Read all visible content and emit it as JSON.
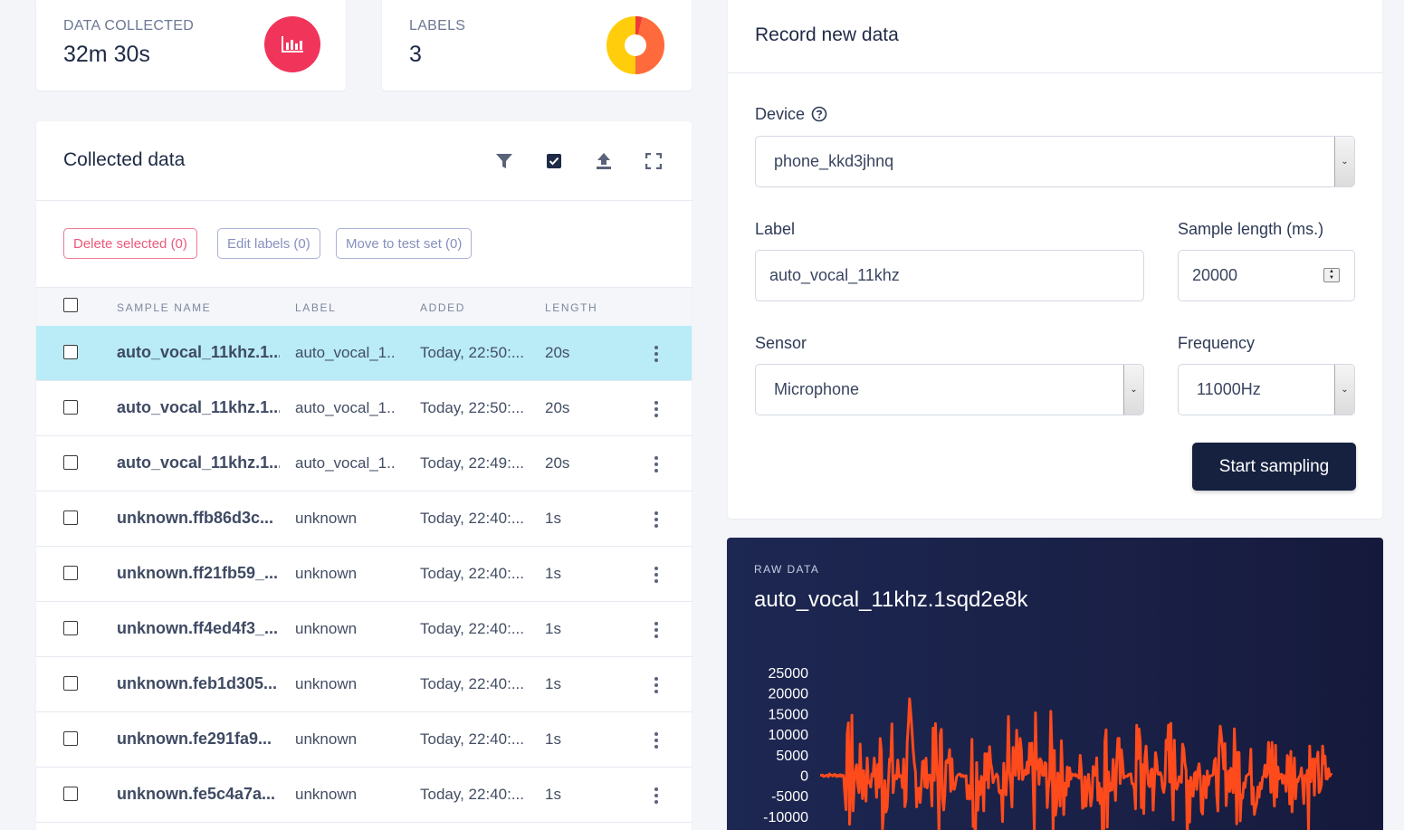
{
  "stats": {
    "data_collected": {
      "label": "DATA COLLECTED",
      "value": "32m 30s",
      "icon": "bar-chart-icon",
      "color": "#f0345a"
    },
    "labels": {
      "label": "LABELS",
      "value": "3",
      "icon": "donut-chart-icon"
    }
  },
  "collected": {
    "title": "Collected data",
    "tools": [
      "filter-icon",
      "select-checkbox-icon",
      "upload-icon",
      "fullscreen-icon"
    ],
    "actions": {
      "delete": "Delete selected (0)",
      "edit": "Edit labels (0)",
      "move": "Move to test set (0)"
    },
    "columns": {
      "name": "SAMPLE NAME",
      "label": "LABEL",
      "added": "ADDED",
      "length": "LENGTH"
    },
    "rows": [
      {
        "name": "auto_vocal_11khz.1...",
        "label": "auto_vocal_1...",
        "added": "Today, 22:50:...",
        "length": "20s"
      },
      {
        "name": "auto_vocal_11khz.1...",
        "label": "auto_vocal_1...",
        "added": "Today, 22:50:...",
        "length": "20s"
      },
      {
        "name": "auto_vocal_11khz.1...",
        "label": "auto_vocal_1...",
        "added": "Today, 22:49:...",
        "length": "20s"
      },
      {
        "name": "unknown.ffb86d3c...",
        "label": "unknown",
        "added": "Today, 22:40:...",
        "length": "1s"
      },
      {
        "name": "unknown.ff21fb59_...",
        "label": "unknown",
        "added": "Today, 22:40:...",
        "length": "1s"
      },
      {
        "name": "unknown.ff4ed4f3_...",
        "label": "unknown",
        "added": "Today, 22:40:...",
        "length": "1s"
      },
      {
        "name": "unknown.feb1d305...",
        "label": "unknown",
        "added": "Today, 22:40:...",
        "length": "1s"
      },
      {
        "name": "unknown.fe291fa9...",
        "label": "unknown",
        "added": "Today, 22:40:...",
        "length": "1s"
      },
      {
        "name": "unknown.fe5c4a7a...",
        "label": "unknown",
        "added": "Today, 22:40:...",
        "length": "1s"
      }
    ]
  },
  "record": {
    "title": "Record new data",
    "device_label": "Device",
    "device_value": "phone_kkd3jhnq",
    "label_label": "Label",
    "label_value": "auto_vocal_11khz",
    "length_label": "Sample length (ms.)",
    "length_value": "20000",
    "sensor_label": "Sensor",
    "sensor_value": "Microphone",
    "freq_label": "Frequency",
    "freq_value": "11000Hz",
    "start_button": "Start sampling"
  },
  "raw": {
    "kicker": "RAW DATA",
    "title": "auto_vocal_11khz.1sqd2e8k"
  },
  "chart_data": {
    "type": "line",
    "series_color": "#ff4a1c",
    "ylim": [
      -10000,
      25000
    ],
    "y_ticks": [
      "25000",
      "20000",
      "15000",
      "10000",
      "5000",
      "0",
      "-5000",
      "-10000"
    ],
    "y_tick_values": [
      25000,
      20000,
      15000,
      10000,
      5000,
      0,
      -5000,
      -10000
    ],
    "x_range": [
      0,
      20000
    ],
    "bursts": [
      {
        "x": 1200,
        "amp": 18000
      },
      {
        "x": 1700,
        "amp": 12000
      },
      {
        "x": 2400,
        "amp": 20000
      },
      {
        "x": 2800,
        "amp": 14000
      },
      {
        "x": 3500,
        "amp": 20000
      },
      {
        "x": 3900,
        "amp": 12000
      },
      {
        "x": 4600,
        "amp": 22000
      },
      {
        "x": 5000,
        "amp": 10000
      },
      {
        "x": 6000,
        "amp": 18000
      },
      {
        "x": 6500,
        "amp": 12000
      },
      {
        "x": 7300,
        "amp": 21000
      },
      {
        "x": 7700,
        "amp": 14000
      },
      {
        "x": 8400,
        "amp": 17000
      },
      {
        "x": 9100,
        "amp": 20000
      },
      {
        "x": 9500,
        "amp": 11000
      },
      {
        "x": 10400,
        "amp": 15000
      },
      {
        "x": 11100,
        "amp": 20000
      },
      {
        "x": 11600,
        "amp": 13000
      },
      {
        "x": 12500,
        "amp": 21000
      },
      {
        "x": 13000,
        "amp": 12000
      },
      {
        "x": 13700,
        "amp": 18000
      },
      {
        "x": 14400,
        "amp": 19000
      },
      {
        "x": 14900,
        "amp": 11000
      },
      {
        "x": 15700,
        "amp": 14000
      },
      {
        "x": 16300,
        "amp": 17000
      },
      {
        "x": 17000,
        "amp": 12000
      },
      {
        "x": 17700,
        "amp": 18000
      },
      {
        "x": 18400,
        "amp": 13000
      },
      {
        "x": 19100,
        "amp": 14000
      },
      {
        "x": 19600,
        "amp": 10000
      }
    ]
  }
}
